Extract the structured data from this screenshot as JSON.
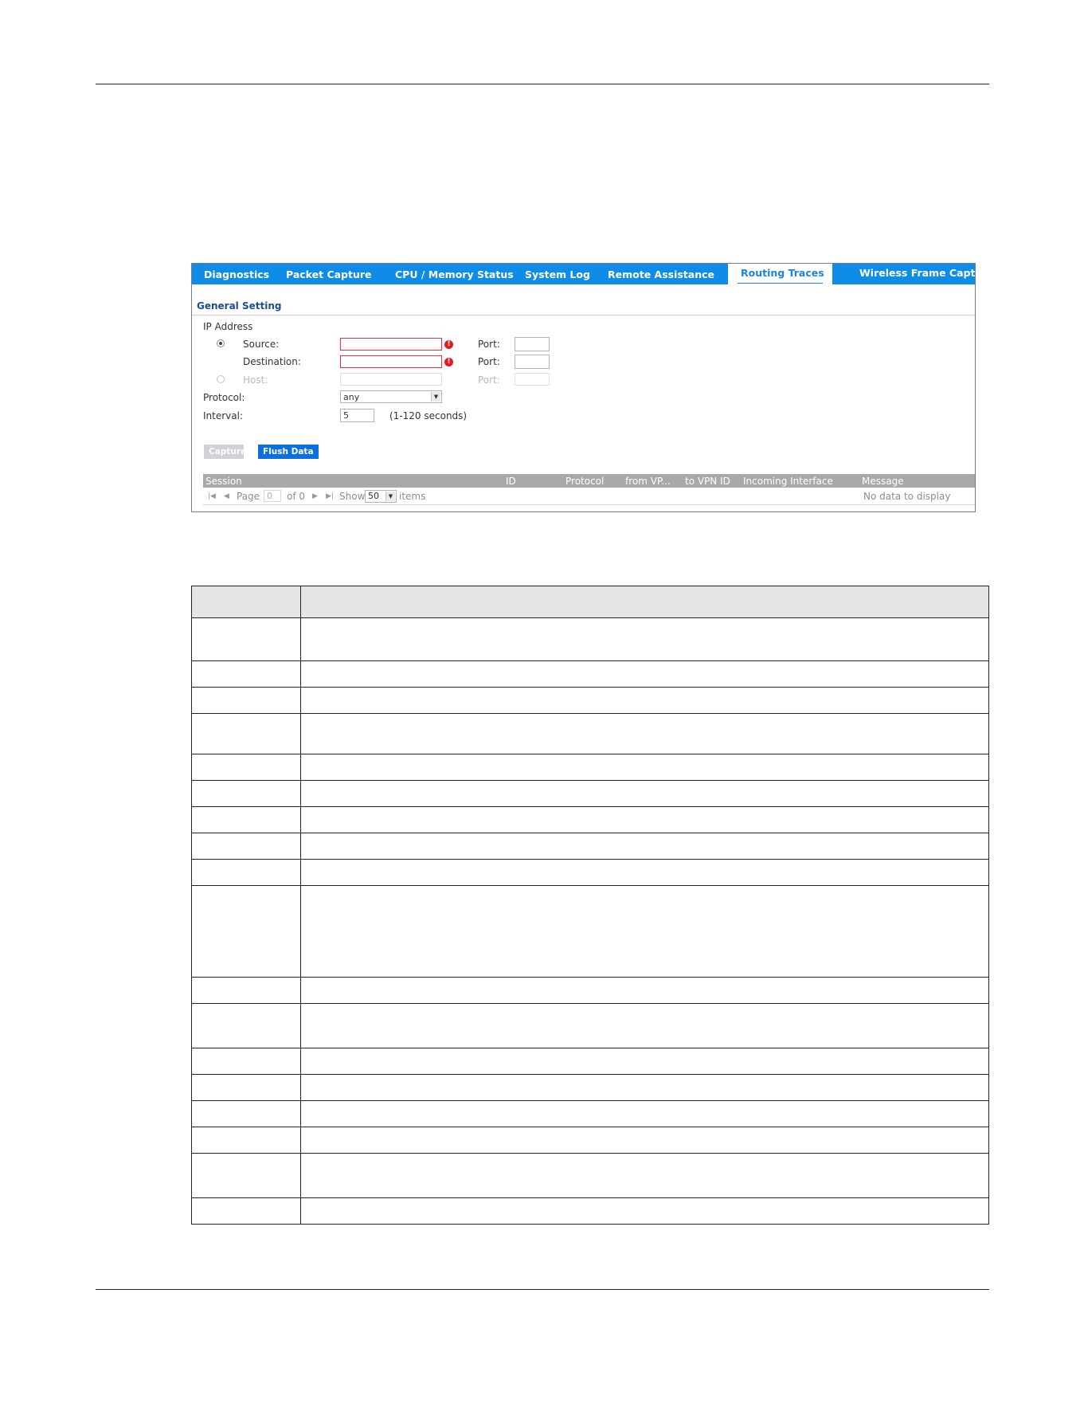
{
  "tabs": [
    {
      "label": "Diagnostics",
      "active": false
    },
    {
      "label": "Packet Capture",
      "active": false
    },
    {
      "label": "CPU / Memory Status",
      "active": false
    },
    {
      "label": "System Log",
      "active": false
    },
    {
      "label": "Remote Assistance",
      "active": false
    },
    {
      "label": "Routing Traces",
      "active": true
    },
    {
      "label": "Wireless Frame Capture",
      "active": false
    }
  ],
  "general_setting": {
    "title": "General Setting",
    "ip_address_label": "IP Address",
    "source_label": "Source:",
    "destination_label": "Destination:",
    "host_label": "Host:",
    "port_label": "Port:",
    "protocol_label": "Protocol:",
    "protocol_value": "any",
    "interval_label": "Interval:",
    "interval_value": "5",
    "interval_hint": "(1-120 seconds)",
    "error_glyph": "!"
  },
  "buttons": {
    "capture": "Capture",
    "flush": "Flush Data"
  },
  "grid": {
    "columns": [
      "Session",
      "ID",
      "Protocol",
      "from VP...",
      "to VPN ID",
      "Incoming Interface",
      "Message"
    ],
    "pager": {
      "page_label": "Page",
      "page_value": "0",
      "of_label": "of 0",
      "show_label": "Show",
      "show_value": "50",
      "items_label": "items",
      "empty_message": "No data to display"
    }
  },
  "colors": {
    "tab_bar": "#0f8ce6",
    "active_tab_text": "#1b84dd",
    "section_title": "#1e4c9a",
    "flush_button": "#0b6fe0",
    "capture_button_disabled": "#d0d3d6",
    "grid_header": "#a9a9a9",
    "error": "#e31b23"
  },
  "description_table_rows": 18
}
